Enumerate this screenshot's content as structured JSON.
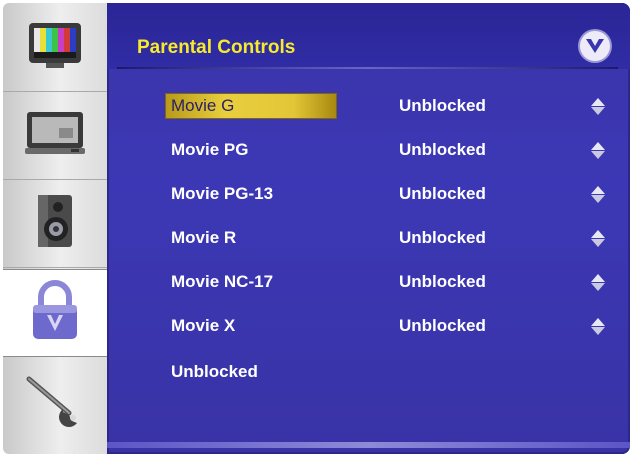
{
  "window": {
    "title": "Parental Controls"
  },
  "sidebar": {
    "items": [
      {
        "icon": "color-bars-tv-icon",
        "active": false
      },
      {
        "icon": "monitor-input-icon",
        "active": false
      },
      {
        "icon": "speaker-icon",
        "active": false
      },
      {
        "icon": "padlock-icon",
        "active": true
      },
      {
        "icon": "wrench-icon",
        "active": false
      }
    ]
  },
  "rows": [
    {
      "label": "Movie G",
      "value": "Unblocked",
      "selected": true
    },
    {
      "label": "Movie PG",
      "value": "Unblocked"
    },
    {
      "label": "Movie PG-13",
      "value": "Unblocked"
    },
    {
      "label": "Movie R",
      "value": "Unblocked"
    },
    {
      "label": "Movie NC-17",
      "value": "Unblocked"
    },
    {
      "label": "Movie X",
      "value": "Unblocked"
    },
    {
      "label": "Unblocked"
    }
  ],
  "colors": {
    "panel": "#3c38b5",
    "title": "#f7ea2c",
    "highlight": "#e3c637"
  }
}
